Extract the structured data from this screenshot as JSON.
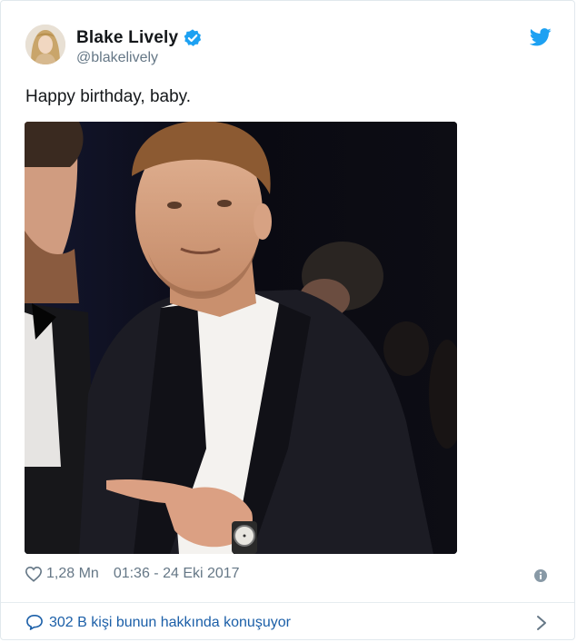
{
  "user": {
    "display_name": "Blake Lively",
    "handle": "@blakelively",
    "verified": true
  },
  "tweet": {
    "text": "Happy birthday, baby.",
    "like_count": "1,28 Mn",
    "timestamp": "01:36 - 24 Eki 2017"
  },
  "conversation": {
    "label": "302 B kişi bunun hakkında konuşuyor"
  },
  "icons": {
    "brand": "twitter-bird-icon",
    "verified": "verified-badge-icon",
    "like": "heart-icon",
    "info": "info-icon",
    "reply": "chat-bubble-icon",
    "more": "chevron-right-icon"
  },
  "colors": {
    "twitter_blue": "#1da1f2",
    "link_blue": "#1b5fa8",
    "secondary_text": "#657786",
    "primary_text": "#14171a",
    "border": "#e1e8ed"
  }
}
